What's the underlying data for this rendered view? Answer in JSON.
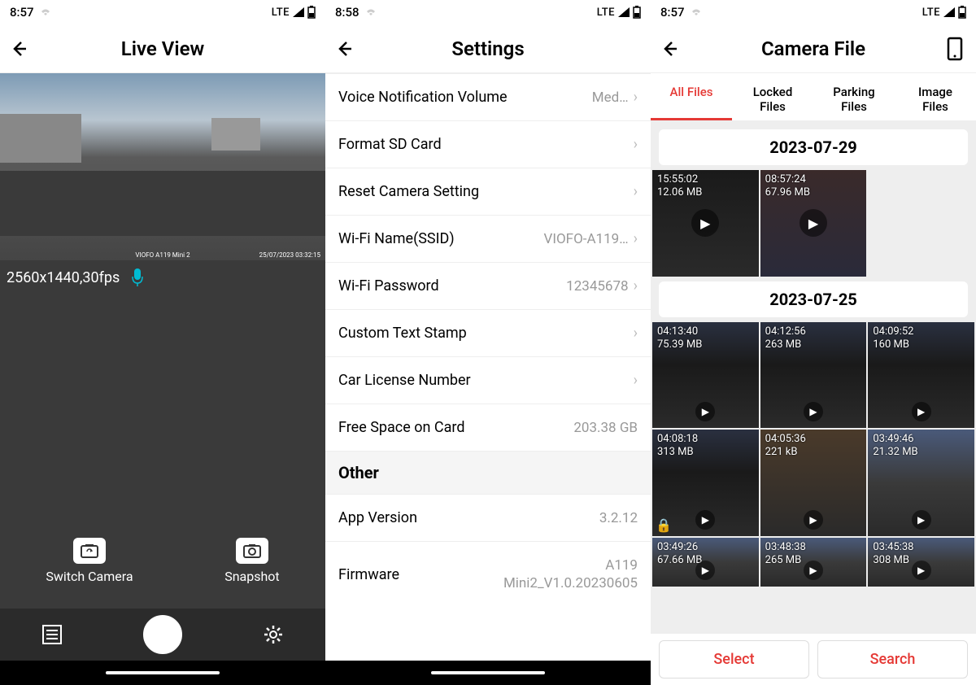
{
  "phone1": {
    "status": {
      "time": "8:57",
      "network": "LTE"
    },
    "header": {
      "title": "Live View"
    },
    "preview": {
      "stamp_left": "VIOFO A119 Mini 2",
      "stamp_right": "25/07/2023 03:32:15"
    },
    "info": {
      "resolution": "2560x1440,30fps"
    },
    "actions": {
      "switch": "Switch Camera",
      "snapshot": "Snapshot"
    }
  },
  "phone2": {
    "status": {
      "time": "8:58",
      "network": "LTE"
    },
    "header": {
      "title": "Settings"
    },
    "rows": {
      "voice": {
        "label": "Voice Notification Volume",
        "value": "Med…"
      },
      "format": {
        "label": "Format SD Card"
      },
      "reset": {
        "label": "Reset Camera Setting"
      },
      "ssid": {
        "label": "Wi-Fi Name(SSID)",
        "value": "VIOFO-A119…"
      },
      "pass": {
        "label": "Wi-Fi Password",
        "value": "12345678"
      },
      "stamp": {
        "label": "Custom Text Stamp"
      },
      "plate": {
        "label": "Car License Number"
      },
      "space": {
        "label": "Free Space on Card",
        "value": "203.38 GB"
      },
      "section": "Other",
      "appv": {
        "label": "App Version",
        "value": "3.2.12"
      },
      "fw": {
        "label": "Firmware",
        "value1": "A119",
        "value2": "Mini2_V1.0.20230605"
      }
    }
  },
  "phone3": {
    "status": {
      "time": "8:57",
      "network": "LTE"
    },
    "header": {
      "title": "Camera File"
    },
    "tabs": {
      "all": "All Files",
      "locked": "Locked Files",
      "parking": "Parking Files",
      "image": "Image Files"
    },
    "dates": {
      "d1": "2023-07-29",
      "d2": "2023-07-25"
    },
    "files": {
      "g1": [
        {
          "time": "15:55:02",
          "size": "12.06 MB"
        },
        {
          "time": "08:57:24",
          "size": "67.96 MB"
        }
      ],
      "g2": [
        {
          "time": "04:13:40",
          "size": "75.39 MB"
        },
        {
          "time": "04:12:56",
          "size": "263 MB"
        },
        {
          "time": "04:09:52",
          "size": "160 MB"
        },
        {
          "time": "04:08:18",
          "size": "313 MB",
          "locked": true
        },
        {
          "time": "04:05:36",
          "size": "221 kB"
        },
        {
          "time": "03:49:46",
          "size": "21.32 MB"
        },
        {
          "time": "03:49:26",
          "size": "67.66 MB"
        },
        {
          "time": "03:48:38",
          "size": "265 MB"
        },
        {
          "time": "03:45:38",
          "size": "308 MB"
        }
      ]
    },
    "buttons": {
      "select": "Select",
      "search": "Search"
    }
  }
}
